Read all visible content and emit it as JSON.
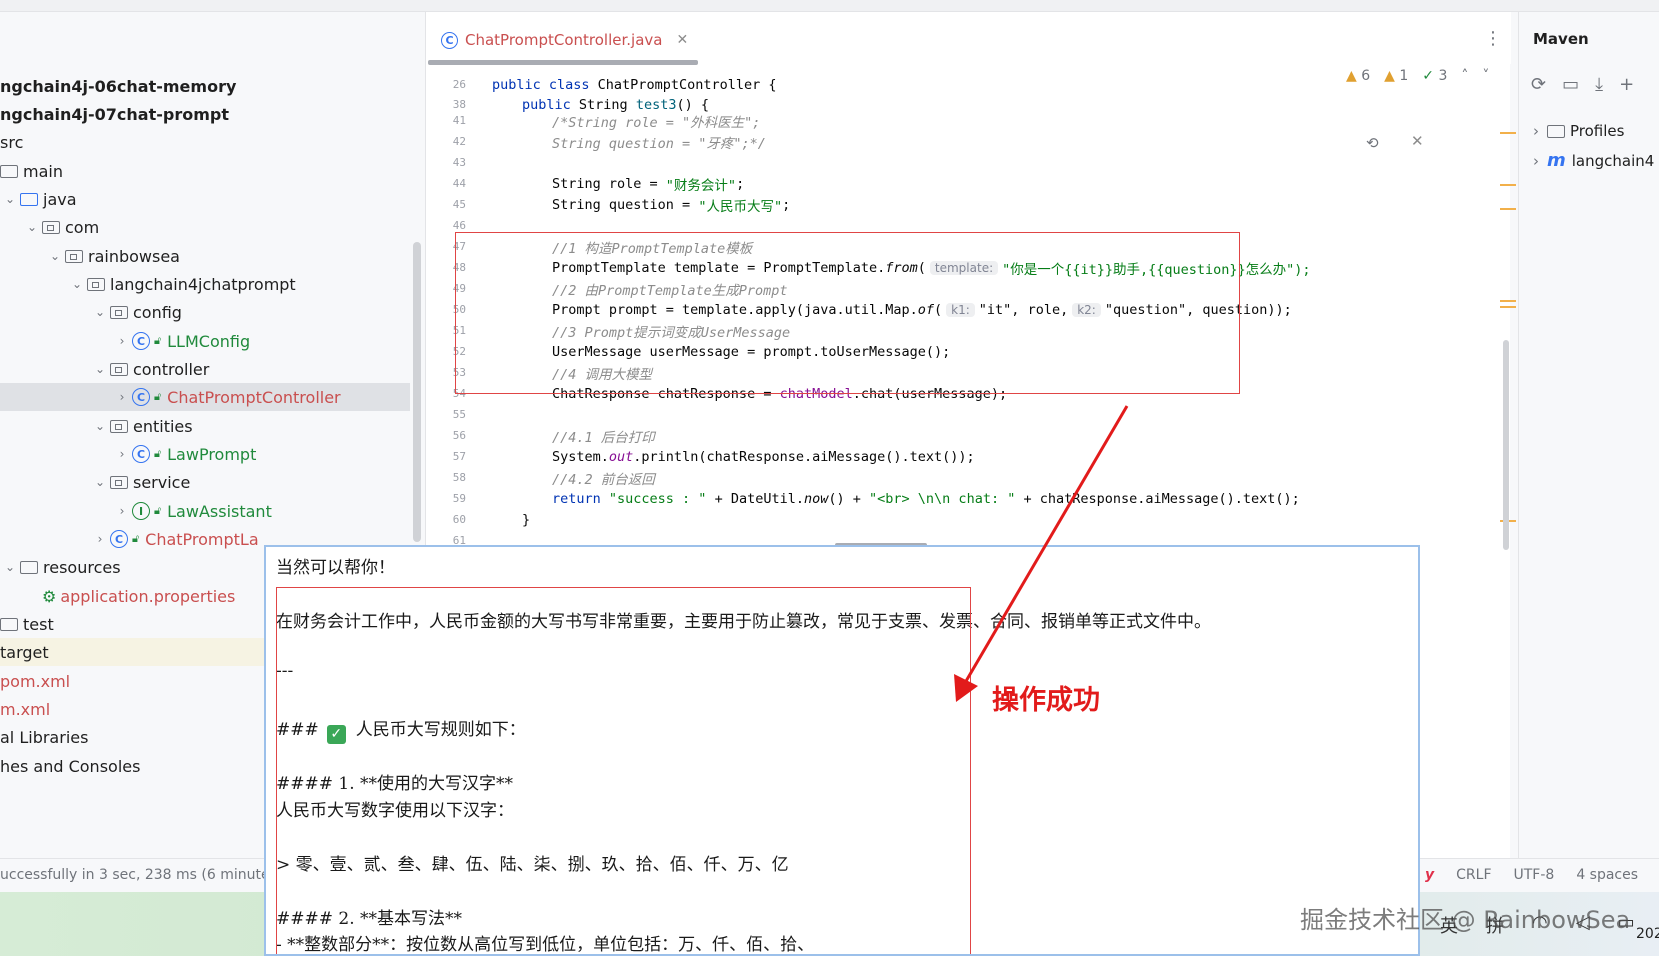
{
  "tree": {
    "rows": [
      {
        "label": "ngchain4j-06chat-memory"
      },
      {
        "label": "ngchain4j-07chat-prompt"
      },
      {
        "label": "src"
      },
      {
        "label": "main"
      },
      {
        "label": "java"
      },
      {
        "label": "com"
      },
      {
        "label": "rainbowsea"
      },
      {
        "label": "langchain4jchatprompt"
      },
      {
        "label": "config"
      },
      {
        "label": "LLMConfig"
      },
      {
        "label": "controller"
      },
      {
        "label": "ChatPromptController"
      },
      {
        "label": "entities"
      },
      {
        "label": "LawPrompt"
      },
      {
        "label": "service"
      },
      {
        "label": "LawAssistant"
      },
      {
        "label": "ChatPromptLa"
      },
      {
        "label": "resources"
      },
      {
        "label": "application.properties"
      },
      {
        "label": "test"
      },
      {
        "label": "target"
      },
      {
        "label": "pom.xml"
      },
      {
        "label": "m.xml"
      },
      {
        "label": "al Libraries"
      },
      {
        "label": "hes and Consoles"
      }
    ]
  },
  "editor": {
    "tab_label": "ChatPromptController.java",
    "inspections": {
      "warnings": "6",
      "weak": "1",
      "ok": "3"
    },
    "sticky": [
      {
        "ln": "26",
        "code": "public class ChatPromptController {"
      },
      {
        "ln": "38",
        "code": "public String test3() {"
      }
    ],
    "lines": [
      {
        "ln": "41",
        "code": "/*String role = \"外科医生\";"
      },
      {
        "ln": "42",
        "code": "String question = \"牙疼\";*/"
      },
      {
        "ln": "43",
        "code": ""
      },
      {
        "ln": "44",
        "code": "String role = \"财务会计\";"
      },
      {
        "ln": "45",
        "code": "String question = \"人民币大写\";"
      },
      {
        "ln": "46",
        "code": ""
      },
      {
        "ln": "47",
        "code": "//1 构造PromptTemplate模板"
      },
      {
        "ln": "48",
        "code": "PromptTemplate template = PromptTemplate.from("
      },
      {
        "ln": "49",
        "code": "//2 由PromptTemplate生成Prompt"
      },
      {
        "ln": "50",
        "code": "Prompt prompt = template.apply(java.util.Map.of("
      },
      {
        "ln": "51",
        "code": "//3 Prompt提示词变成UserMessage"
      },
      {
        "ln": "52",
        "code": "UserMessage userMessage = prompt.toUserMessage();"
      },
      {
        "ln": "53",
        "code": "//4 调用大模型"
      },
      {
        "ln": "54",
        "code": "ChatResponse chatResponse = chatModel.chat(userMessage);"
      },
      {
        "ln": "55",
        "code": ""
      },
      {
        "ln": "56",
        "code": "//4.1 后台打印"
      },
      {
        "ln": "57",
        "code": "System.out.println(chatResponse.aiMessage().text());"
      },
      {
        "ln": "58",
        "code": "//4.2 前台返回"
      },
      {
        "ln": "59",
        "code": "return \"success : \" + DateUtil.now() + \"<br> \\n\\n chat: \" + chatResponse.aiMessage().text();"
      },
      {
        "ln": "60",
        "code": "}"
      },
      {
        "ln": "61",
        "code": ""
      }
    ],
    "line48_hint": "template:",
    "line48_arg": "\"你是一个{{it}}助手,{{question}}怎么办\");",
    "line50_hint1": "k1:",
    "line50_arg1": "\"it\", role,",
    "line50_hint2": "k2:",
    "line50_arg2": "\"question\", question));"
  },
  "maven": {
    "title": "Maven",
    "profiles": "Profiles",
    "project": "langchain4"
  },
  "status": {
    "left": "uccessfully in 3 sec, 238 ms (6 minute",
    "crlf": "CRLF",
    "encoding": "UTF-8",
    "indent": "4 spaces"
  },
  "overlay": {
    "l1": "当然可以帮你！",
    "l2": "在财务会计工作中，人民币金额的大写书写非常重要，主要用于防止篡改，常见于支票、发票、合同、报销单等正式文件中。",
    "l3": "---",
    "l4_prefix": "###",
    "l4_text": "人民币大写规则如下：",
    "l5": "#### 1. **使用的大写汉字**",
    "l6": "人民币大写数字使用以下汉字：",
    "l7": "> 零、壹、贰、叁、肆、伍、陆、柒、捌、玖、拾、佰、仟、万、亿",
    "l8": "#### 2. **基本写法**",
    "l9": "- **整数部分**：按位数从高位写到低位，单位包括：万、仟、佰、拾、"
  },
  "annotation": "操作成功",
  "watermark": "掘金技术社区 @ RainbowSea",
  "tray": {
    "lang": "英",
    "ime": "拼",
    "year": "202"
  },
  "colors": {
    "accent": "#3574f0",
    "annotation_red": "#e21b1b",
    "string_green": "#067d17",
    "keyword_blue": "#0033b3"
  }
}
